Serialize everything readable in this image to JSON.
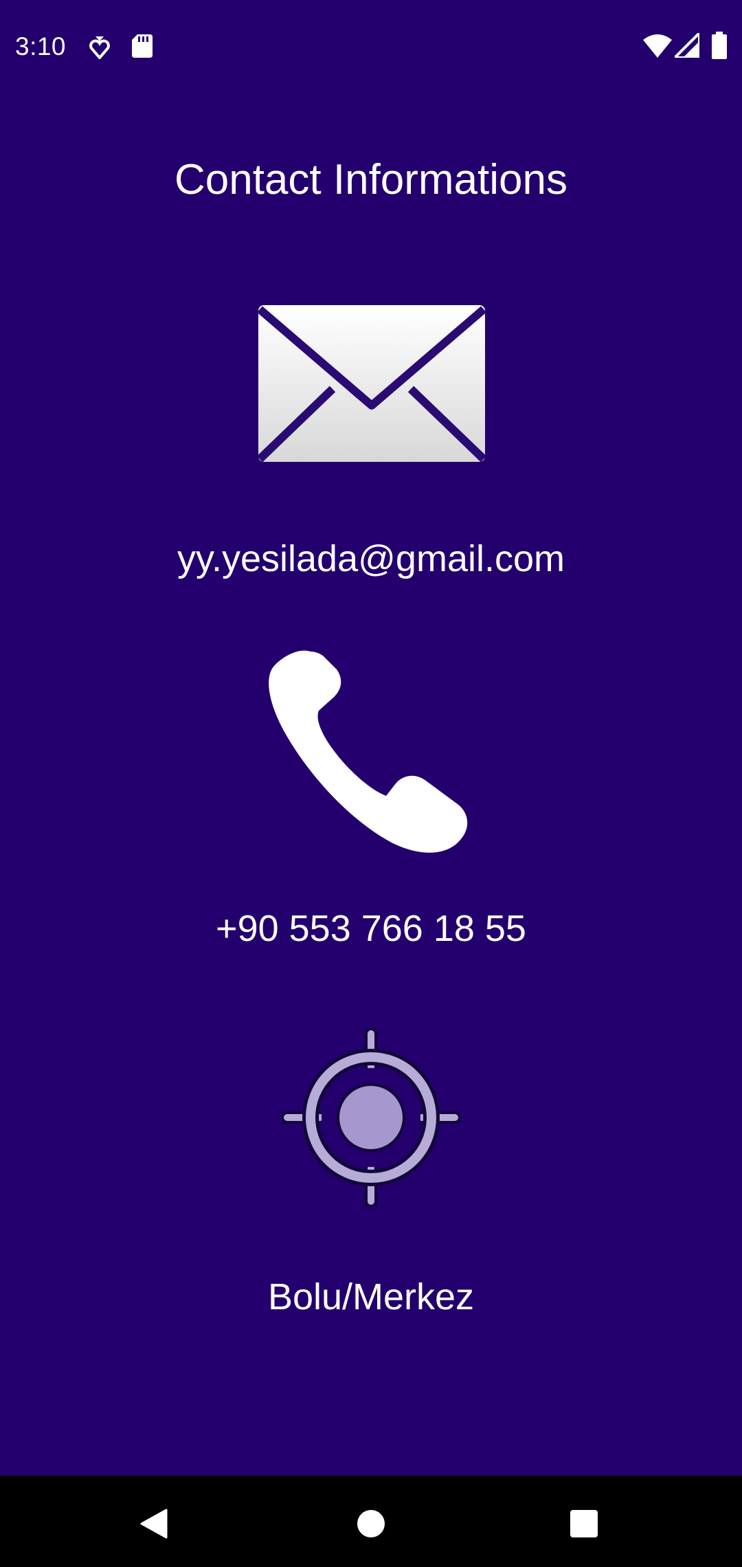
{
  "status_bar": {
    "time": "3:10"
  },
  "page": {
    "title": "Contact Informations"
  },
  "contact": {
    "email": "yy.yesilada@gmail.com",
    "phone": "+90 553 766 18 55",
    "location": "Bolu/Merkez"
  },
  "icons": {
    "email": "envelope-icon",
    "phone": "phone-handset-icon",
    "location": "location-target-icon"
  },
  "colors": {
    "background": "#23006e",
    "text": "#ffffff",
    "nav_bar": "#000000"
  }
}
